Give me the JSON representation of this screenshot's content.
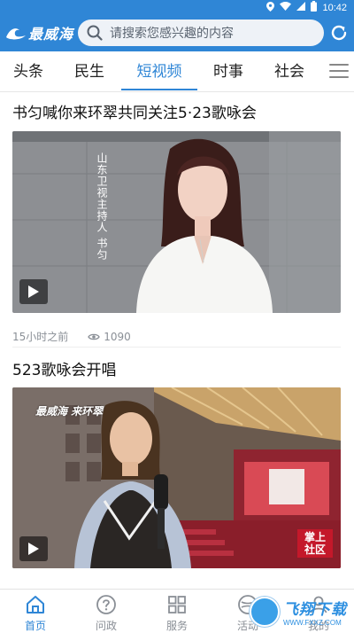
{
  "status_bar": {
    "time": "10:42"
  },
  "header": {
    "logo_text": "最威海",
    "search_placeholder": "请搜索您感兴趣的内容"
  },
  "tabs": [
    {
      "label": "头条",
      "active": false
    },
    {
      "label": "民生",
      "active": false
    },
    {
      "label": "短视频",
      "active": true
    },
    {
      "label": "时事",
      "active": false
    },
    {
      "label": "社会",
      "active": false
    }
  ],
  "feed": [
    {
      "title": "书匀喊你来环翠共同关注5·23歌咏会",
      "overlay_vertical_text": "山东卫视主持人 书匀",
      "time_ago": "15小时之前",
      "views": "1090"
    },
    {
      "title": "523歌咏会开唱",
      "overlay_logo_text": "最威海 来环翠",
      "overlay_corner_text": "掌上社区"
    }
  ],
  "bottom_nav": [
    {
      "label": "首页",
      "icon": "home-icon",
      "active": true
    },
    {
      "label": "问政",
      "icon": "question-icon",
      "active": false
    },
    {
      "label": "服务",
      "icon": "grid-icon",
      "active": false
    },
    {
      "label": "活动",
      "icon": "activity-icon",
      "active": false
    },
    {
      "label": "我的",
      "icon": "user-icon",
      "active": false
    }
  ],
  "watermark": {
    "main": "飞翔下载",
    "sub": "WWW.FXXZ.COM"
  },
  "colors": {
    "brand_blue": "#2f86d6",
    "search_bg": "#eef2f7",
    "meta_gray": "#8a8f96"
  }
}
